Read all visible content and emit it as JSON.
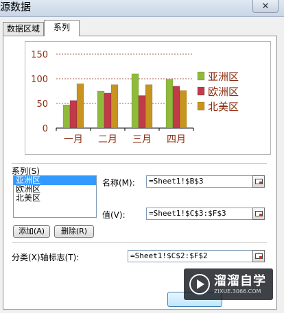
{
  "window": {
    "title": "源数据",
    "close_label": "✕"
  },
  "tabs": [
    {
      "label": "数据区域"
    },
    {
      "label": "系列",
      "active": true
    }
  ],
  "chart_data": {
    "type": "bar",
    "categories": [
      "一月",
      "二月",
      "三月",
      "四月"
    ],
    "series": [
      {
        "name": "亚洲区",
        "values": [
          47,
          75,
          110,
          99
        ],
        "color": "#8fba3c"
      },
      {
        "name": "欧洲区",
        "values": [
          56,
          71,
          66,
          85
        ],
        "color": "#c03a4a"
      },
      {
        "name": "北美区",
        "values": [
          90,
          88,
          88,
          76
        ],
        "color": "#c8941e"
      }
    ],
    "yticks": [
      "0",
      "50",
      "100",
      "150"
    ],
    "ylim": [
      0,
      150
    ],
    "grid": "dashed horizontal",
    "legend": "right",
    "title": "",
    "xlabel": "",
    "ylabel": ""
  },
  "series_section": {
    "label": "系列(S)",
    "items": [
      "亚洲区",
      "欧洲区",
      "北美区"
    ],
    "selected_index": 0,
    "add_label": "添加(A)",
    "delete_label": "删除(R)"
  },
  "fields": {
    "name_label": "名称(M):",
    "name_value": "=Sheet1!$B$3",
    "values_label": "值(V):",
    "values_value": "=Sheet1!$C$3:$F$3",
    "category_label": "分类(X)轴标志(T):",
    "category_value": "=Sheet1!$C$2:$F$2"
  },
  "watermark": {
    "text": "溜溜自学",
    "url": "ZIXUE.3066.COM"
  },
  "colors": {
    "axis_text": "#8b2c0e",
    "grid": "#8b2c0e"
  }
}
